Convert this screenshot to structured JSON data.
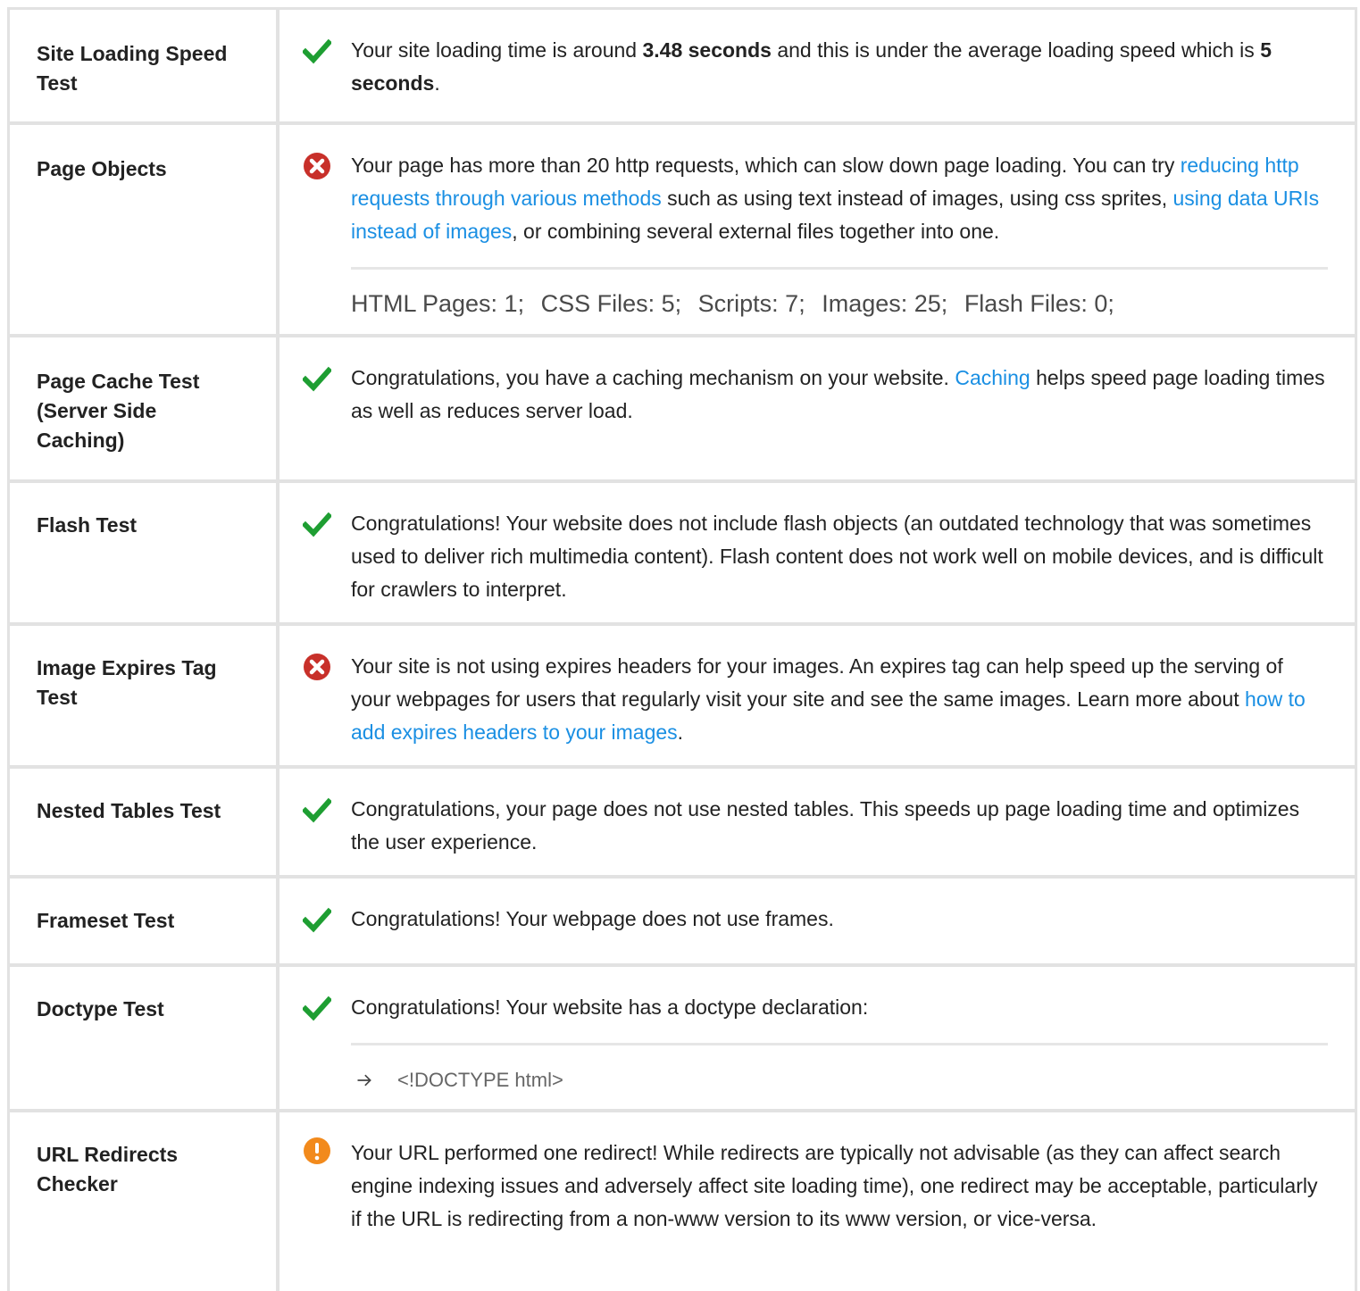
{
  "rows": [
    {
      "label": "Site Loading Speed Test",
      "status": "pass",
      "parts": [
        "Your site loading time is around ",
        "3.48 seconds",
        " and this is under the average loading speed which is ",
        "5 seconds",
        "."
      ]
    },
    {
      "label": "Page Objects",
      "status": "fail",
      "parts": [
        "Your page has more than 20 http requests, which can slow down page loading. You can try ",
        "reducing http requests through various methods",
        " such as using text instead of images, using css sprites, ",
        "using data URIs instead of images",
        ", or combining several external files together into one."
      ],
      "counts": [
        "HTML Pages: 1;",
        "CSS Files: 5;",
        "Scripts: 7;",
        "Images: 25;",
        "Flash Files: 0;"
      ]
    },
    {
      "label": "Page Cache Test (Server Side Caching)",
      "status": "pass",
      "parts": [
        "Congratulations, you have a caching mechanism on your website. ",
        "Caching",
        " helps speed page loading times as well as reduces server load."
      ]
    },
    {
      "label": "Flash Test",
      "status": "pass",
      "parts": [
        "Congratulations! Your website does not include flash objects (an outdated technology that was sometimes used to deliver rich multimedia content). Flash content does not work well on mobile devices, and is difficult for crawlers to interpret."
      ]
    },
    {
      "label": "Image Expires Tag Test",
      "status": "fail",
      "parts": [
        "Your site is not using expires headers for your images. An expires tag can help speed up the serving of your webpages for users that regularly visit your site and see the same images. Learn more about ",
        "how to add expires headers to your images",
        "."
      ]
    },
    {
      "label": "Nested Tables Test",
      "status": "pass",
      "parts": [
        "Congratulations, your page does not use nested tables. This speeds up page loading time and optimizes the user experience."
      ]
    },
    {
      "label": "Frameset Test",
      "status": "pass",
      "parts": [
        "Congratulations! Your webpage does not use frames."
      ]
    },
    {
      "label": "Doctype Test",
      "status": "pass",
      "parts": [
        "Congratulations! Your website has a doctype declaration:"
      ],
      "doctype": "<!DOCTYPE html>"
    },
    {
      "label": "URL Redirects Checker",
      "status": "warning",
      "parts": [
        "Your URL performed one redirect! While redirects are typically not advisable (as they can affect search engine indexing issues and adversely affect site loading time), one redirect may be acceptable, particularly if the URL is redirecting from a non-www version to its www version, or vice-versa."
      ]
    }
  ],
  "colors": {
    "pass": "#1e9e32",
    "fail": "#c8302a",
    "warning": "#f28a1c",
    "link": "#1a8fe3"
  }
}
